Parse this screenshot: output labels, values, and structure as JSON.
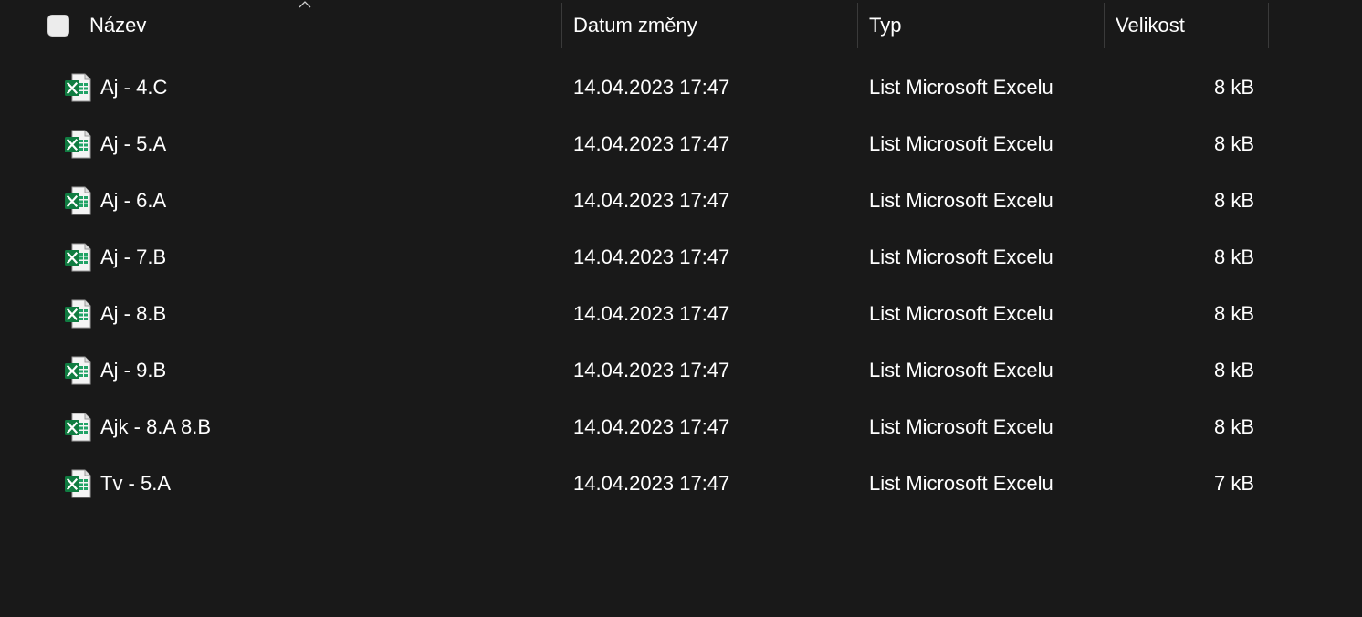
{
  "header": {
    "name_label": "Název",
    "date_label": "Datum změny",
    "type_label": "Typ",
    "size_label": "Velikost",
    "sort_indicator_icon": "chevron-up-icon"
  },
  "files": [
    {
      "name": "Aj - 4.C",
      "date": "14.04.2023 17:47",
      "type": "List Microsoft Excelu",
      "size": "8 kB",
      "icon": "excel-file-icon"
    },
    {
      "name": "Aj - 5.A",
      "date": "14.04.2023 17:47",
      "type": "List Microsoft Excelu",
      "size": "8 kB",
      "icon": "excel-file-icon"
    },
    {
      "name": "Aj - 6.A",
      "date": "14.04.2023 17:47",
      "type": "List Microsoft Excelu",
      "size": "8 kB",
      "icon": "excel-file-icon"
    },
    {
      "name": "Aj - 7.B",
      "date": "14.04.2023 17:47",
      "type": "List Microsoft Excelu",
      "size": "8 kB",
      "icon": "excel-file-icon"
    },
    {
      "name": "Aj - 8.B",
      "date": "14.04.2023 17:47",
      "type": "List Microsoft Excelu",
      "size": "8 kB",
      "icon": "excel-file-icon"
    },
    {
      "name": "Aj - 9.B",
      "date": "14.04.2023 17:47",
      "type": "List Microsoft Excelu",
      "size": "8 kB",
      "icon": "excel-file-icon"
    },
    {
      "name": "Ajk - 8.A 8.B",
      "date": "14.04.2023 17:47",
      "type": "List Microsoft Excelu",
      "size": "8 kB",
      "icon": "excel-file-icon"
    },
    {
      "name": "Tv - 5.A",
      "date": "14.04.2023 17:47",
      "type": "List Microsoft Excelu",
      "size": "7 kB",
      "icon": "excel-file-icon"
    }
  ],
  "colors": {
    "background": "#191919",
    "text": "#ffffff",
    "separator": "#3a3a3a",
    "excel_green": "#107c41"
  }
}
